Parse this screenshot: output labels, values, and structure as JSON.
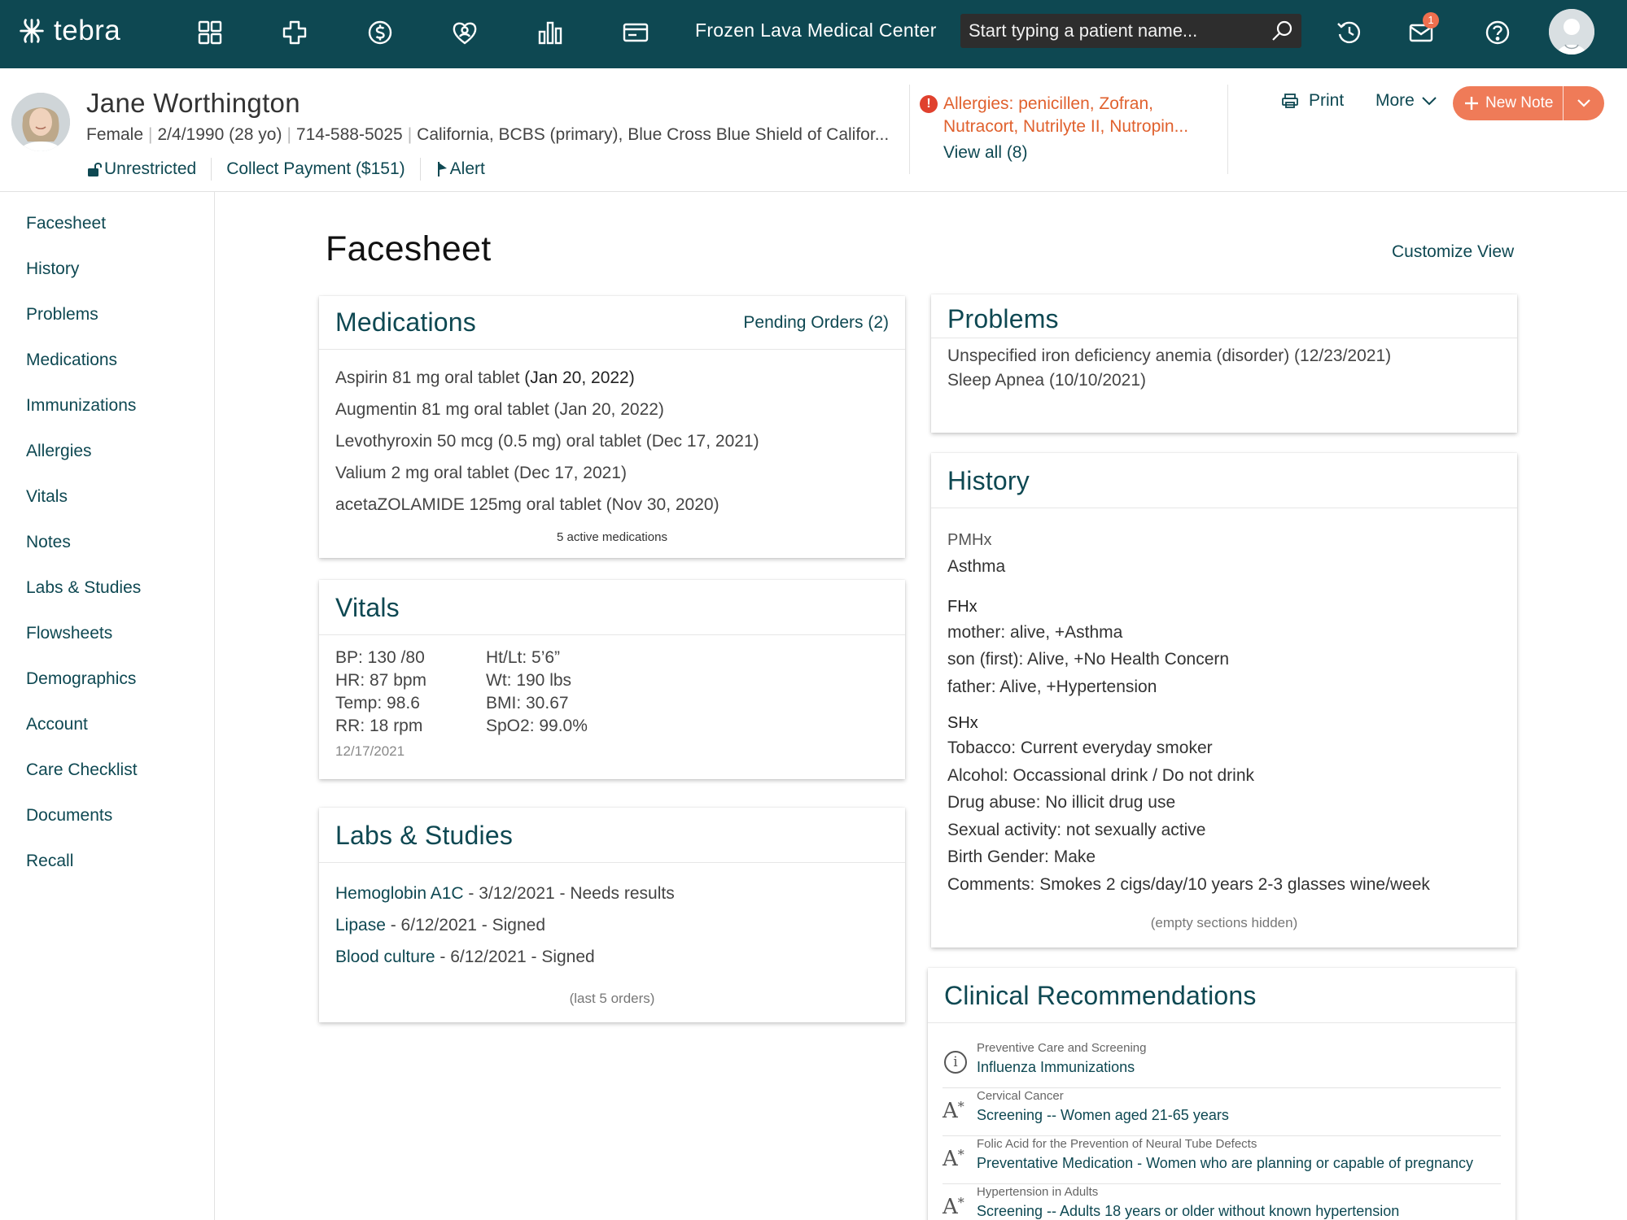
{
  "app": {
    "brand": "tebra",
    "org_name": "Frozen Lava Medical Center"
  },
  "search": {
    "placeholder": "Start typing a patient name..."
  },
  "nav_icons": [
    "dashboard-icon",
    "clinical-cross-icon",
    "billing-dollar-icon",
    "patient-engagement-icon",
    "reports-chart-icon",
    "payments-card-icon"
  ],
  "header_right": {
    "mail_count": "1"
  },
  "patient": {
    "name": "Jane Worthington",
    "gender": "Female",
    "dob": "2/4/1990 (28 yo)",
    "phone": "714-588-5025",
    "insurance": "California, BCBS (primary), Blue Cross Blue Shield of Califor...",
    "access": "Unrestricted",
    "collect_payment": "Collect Payment ($151)",
    "alert": "Alert",
    "allergies": "Allergies: penicillen, Zofran, Nutracort, Nutrilyte II, Nutropin...",
    "allergies_line1": "Allergies: penicillen, Zofran,",
    "allergies_line2": "Nutracort, Nutrilyte II, Nutropin...",
    "allergies_view_all": "View all (8)"
  },
  "actions": {
    "print": "Print",
    "more": "More",
    "new_note": "New Note"
  },
  "sidebar": {
    "items": [
      "Facesheet",
      "History",
      "Problems",
      "Medications",
      "Immunizations",
      "Allergies",
      "Vitals",
      "Notes",
      "Labs & Studies",
      "Flowsheets",
      "Demographics",
      "Account",
      "Care Checklist",
      "Documents",
      "Recall"
    ]
  },
  "page": {
    "title": "Facesheet",
    "customize": "Customize View"
  },
  "medications": {
    "title": "Medications",
    "pending": "Pending Orders (2)",
    "items": [
      {
        "name": "Aspirin 81 mg oral tablet",
        "date": "(Jan 20, 2022)"
      },
      {
        "name": "Augmentin 81 mg oral tablet",
        "date": "(Jan 20, 2022)"
      },
      {
        "name": "Levothyroxin 50 mcg (0.5 mg) oral tablet",
        "date": "(Dec 17, 2021)"
      },
      {
        "name": "Valium 2 mg oral tablet",
        "date": "(Dec 17, 2021)"
      },
      {
        "name": "acetaZOLAMIDE 125mg oral tablet",
        "date": "(Nov 30, 2020)"
      }
    ],
    "footer": "5 active medications"
  },
  "vitals": {
    "title": "Vitals",
    "left": [
      "BP: 130 /80",
      "HR: 87 bpm",
      "Temp: 98.6",
      "RR: 18 rpm"
    ],
    "right": [
      "Ht/Lt: 5’6”",
      "Wt: 190 lbs",
      "BMI: 30.67",
      "SpO2: 99.0%"
    ],
    "date": "12/17/2021"
  },
  "labs": {
    "title": "Labs & Studies",
    "items": [
      {
        "name": "Hemoglobin A1C",
        "detail": " - 3/12/2021 - Needs results"
      },
      {
        "name": "Lipase",
        "detail": " - 6/12/2021 - Signed"
      },
      {
        "name": "Blood culture",
        "detail": " - 6/12/2021 - Signed"
      }
    ],
    "footer": "(last 5 orders)"
  },
  "problems": {
    "title": "Problems",
    "items": [
      "Unspecified iron deficiency anemia (disorder) (12/23/2021)",
      "Sleep Apnea (10/10/2021)"
    ]
  },
  "history": {
    "title": "History",
    "pmhx_label": "PMHx",
    "pmhx": [
      "Asthma"
    ],
    "fhx_label": "FHx",
    "fhx": [
      "mother: alive, +Asthma",
      "son (first): Alive, +No Health Concern",
      "father: Alive, +Hypertension"
    ],
    "shx_label": "SHx",
    "shx": [
      "Tobacco: Current everyday smoker",
      "Alcohol: Occassional drink / Do not drink",
      "Drug abuse: No illicit drug use",
      "Sexual activity: not sexually active",
      "Birth Gender: Make",
      "Comments: Smokes 2 cigs/day/10 years 2-3 glasses wine/week"
    ],
    "footer": "(empty sections hidden)"
  },
  "recommendations": {
    "title": "Clinical Recommendations",
    "items": [
      {
        "icon": "info-icon",
        "category": "Preventive Care and Screening",
        "link": "Influenza Immunizations"
      },
      {
        "icon": "grade-a-icon",
        "category": "Cervical Cancer",
        "link": "Screening -- Women aged 21-65 years"
      },
      {
        "icon": "grade-a-icon",
        "category": "Folic Acid for the Prevention of Neural Tube Defects",
        "link": "Preventative Medication - Women who are planning or capable of pregnancy"
      },
      {
        "icon": "grade-a-icon",
        "category": "Hypertension in Adults",
        "link": "Screening -- Adults 18 years or older without known hypertension"
      }
    ]
  },
  "colors": {
    "brand": "#0e4852",
    "accent": "#ef7b58",
    "alert": "#e0412e"
  }
}
